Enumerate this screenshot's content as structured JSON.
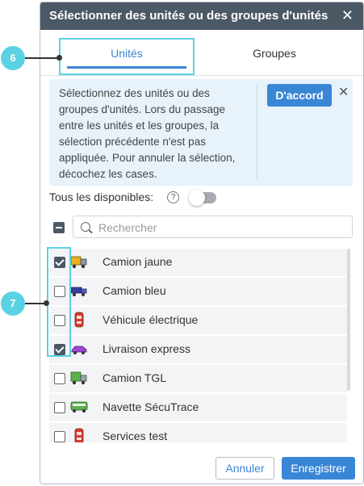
{
  "dialog": {
    "title": "Sélectionner des unités ou des groupes d'unités",
    "close_glyph": "✕"
  },
  "tabs": [
    {
      "label": "Unités",
      "active": true
    },
    {
      "label": "Groupes",
      "active": false
    }
  ],
  "info": {
    "text": "Sélectionnez des unités ou des groupes d'unités. Lors du passage entre les unités et les groupes, la sélection précédente n'est pas appliquée. Pour annuler la sélection, décochez les cases.",
    "ok_label": "D'accord",
    "close_glyph": "✕"
  },
  "available": {
    "label": "Tous les disponibles:",
    "help_glyph": "?",
    "toggle_on": false
  },
  "search": {
    "placeholder": "Rechercher"
  },
  "units": [
    {
      "name": "Camion jaune",
      "checked": true,
      "icon": "yellow-truck-icon"
    },
    {
      "name": "Camion bleu",
      "checked": false,
      "icon": "blue-truck-icon"
    },
    {
      "name": "Véhicule électrique",
      "checked": false,
      "icon": "red-car-icon"
    },
    {
      "name": "Livraison express",
      "checked": true,
      "icon": "purple-car-icon"
    },
    {
      "name": "Camion TGL",
      "checked": false,
      "icon": "green-truck-icon"
    },
    {
      "name": "Navette SécuTrace",
      "checked": false,
      "icon": "green-bus-icon"
    },
    {
      "name": "Services test",
      "checked": false,
      "icon": "red-car-icon"
    }
  ],
  "footer": {
    "cancel_label": "Annuler",
    "save_label": "Enregistrer"
  },
  "callouts": {
    "tab_callout": "6",
    "checkbox_callout": "7"
  },
  "colors": {
    "titlebar": "#4b5866",
    "accent": "#3a86d6",
    "callout": "#5ad2e3",
    "info_bg": "#e7f2fb"
  }
}
